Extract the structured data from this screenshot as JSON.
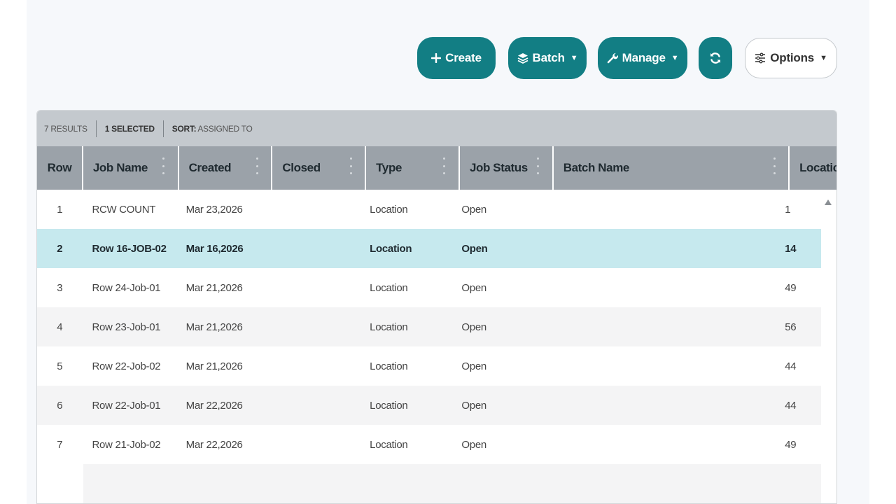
{
  "toolbar": {
    "create_label": "Create",
    "batch_label": "Batch",
    "manage_label": "Manage",
    "options_label": "Options",
    "accent_color": "#127e84"
  },
  "summary": {
    "results": "7 RESULTS",
    "selected": "1 SELECTED",
    "sort_label": "SORT:",
    "sort_value": "ASSIGNED TO"
  },
  "columns": {
    "row": "Row",
    "job_name": "Job Name",
    "created": "Created",
    "closed": "Closed",
    "type": "Type",
    "job_status": "Job Status",
    "batch_name": "Batch Name",
    "location": "Locatic"
  },
  "rows": [
    {
      "row": "1",
      "job_name": "RCW COUNT",
      "created": "Mar 23,2026",
      "closed": "",
      "type": "Location",
      "job_status": "Open",
      "batch_name": "",
      "location": "1"
    },
    {
      "row": "2",
      "job_name": "Row 16-JOB-02",
      "created": "Mar 16,2026",
      "closed": "",
      "type": "Location",
      "job_status": "Open",
      "batch_name": "",
      "location": "14"
    },
    {
      "row": "3",
      "job_name": "Row 24-Job-01",
      "created": "Mar 21,2026",
      "closed": "",
      "type": "Location",
      "job_status": "Open",
      "batch_name": "",
      "location": "49"
    },
    {
      "row": "4",
      "job_name": "Row 23-Job-01",
      "created": "Mar 21,2026",
      "closed": "",
      "type": "Location",
      "job_status": "Open",
      "batch_name": "",
      "location": "56"
    },
    {
      "row": "5",
      "job_name": "Row 22-Job-02",
      "created": "Mar 21,2026",
      "closed": "",
      "type": "Location",
      "job_status": "Open",
      "batch_name": "",
      "location": "44"
    },
    {
      "row": "6",
      "job_name": "Row 22-Job-01",
      "created": "Mar 22,2026",
      "closed": "",
      "type": "Location",
      "job_status": "Open",
      "batch_name": "",
      "location": "44"
    },
    {
      "row": "7",
      "job_name": "Row 21-Job-02",
      "created": "Mar 22,2026",
      "closed": "",
      "type": "Location",
      "job_status": "Open",
      "batch_name": "",
      "location": "49"
    }
  ],
  "selected_row_index": 1,
  "icons": {
    "create": "plus-icon",
    "batch": "layers-icon",
    "manage": "wrench-icon",
    "refresh": "refresh-icon",
    "options": "sliders-icon"
  }
}
